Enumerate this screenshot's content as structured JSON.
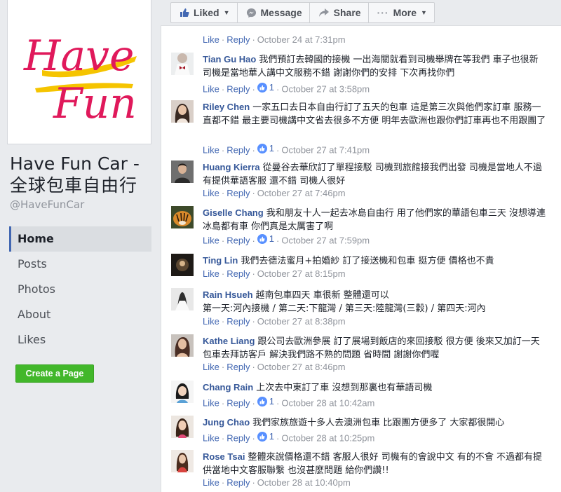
{
  "page": {
    "name": "Have Fun Car -",
    "name_zh": "全球包車自由行",
    "handle": "@HaveFunCar",
    "logo_line1": "Have",
    "logo_line2": "Fun"
  },
  "nav": {
    "items": [
      {
        "label": "Home",
        "active": true
      },
      {
        "label": "Posts"
      },
      {
        "label": "Photos"
      },
      {
        "label": "About"
      },
      {
        "label": "Likes"
      }
    ],
    "create_page": "Create a Page"
  },
  "actions": {
    "liked": "Liked",
    "message": "Message",
    "share": "Share",
    "more": "More"
  },
  "meta": {
    "like": "Like",
    "reply": "Reply",
    "dot": "·"
  },
  "top_meta": {
    "time": "October 24 at 7:31pm"
  },
  "comments": [
    {
      "author": "Tian Gu Hao",
      "text": "我們預訂去韓國的接機 一出海關就看到司機舉牌在等我們 車子也很新 司機是當地華人講中文服務不錯 謝謝你們的安排 下次再找你們",
      "reactions": "1",
      "time": "October 27 at 3:58pm"
    },
    {
      "author": "Riley Chen",
      "text": "一家五口去日本自由行訂了五天的包車 這是第三次與他們家訂車 服務一直都不錯 最主要司機講中文省去很多不方便 明年去歐洲也跟你們訂車再也不用跟團了",
      "reactions": "1",
      "time": "October 27 at 7:41pm"
    },
    {
      "author": "Huang Kierra",
      "text": "從曼谷去華欣訂了單程接駁 司機到旅館接我們出發 司機是當地人不過有提供華語客服 還不錯 司機人很好",
      "reactions": "",
      "time": "October 27 at 7:46pm"
    },
    {
      "author": "Giselle Chang",
      "text": "我和朋友十人一起去冰島自由行 用了他們家的華語包車三天 沒想導連冰島都有車 你們真是太厲害了啊",
      "reactions": "1",
      "time": "October 27 at 7:59pm"
    },
    {
      "author": "Ting Lin",
      "text": "我們去德法蜜月+拍婚紗 訂了接送機和包車 挺方便 價格也不貴",
      "reactions": "",
      "time": "October 27 at 8:15pm"
    },
    {
      "author": "Rain Hsueh",
      "text": "越南包車四天 車很新 整體還可以",
      "text2": "第一天:河內接機 / 第二天:下龍灣 / 第三天:陸龍灣(三穀) / 第四天:河內",
      "reactions": "",
      "time": "October 27 at 8:38pm"
    },
    {
      "author": "Kathe Liang",
      "text": "跟公司去歐洲參展 訂了展場到飯店的來回接駁 很方便 後來又加訂一天包車去拜訪客戶 解決我們路不熟的問題 省時間 謝謝你們喔",
      "reactions": "",
      "time": "October 27 at 8:46pm"
    },
    {
      "author": "Chang Rain",
      "text": "上次去中東訂了車 沒想到那裏也有華語司機",
      "reactions": "1",
      "time": "October 28 at 10:42am"
    },
    {
      "author": "Jung Chao",
      "text": "我們家族旅遊十多人去澳洲包車 比跟團方便多了 大家都很開心",
      "reactions": "1",
      "time": "October 28 at 10:25pm"
    },
    {
      "author": "Rose Tsai",
      "text": "整體來說價格還不錯 客服人很好 司機有的會說中文 有的不會 不過都有提供當地中文客服聯繫 也沒甚麼問題 給你們讚!!",
      "reactions": "",
      "time": "October 28 at 10:40pm"
    }
  ],
  "colors": {
    "link": "#4267b2",
    "author": "#365899",
    "meta": "#90949c",
    "create_button": "#42b72a",
    "logo_red": "#e0195b",
    "logo_yellow": "#f5c400"
  }
}
